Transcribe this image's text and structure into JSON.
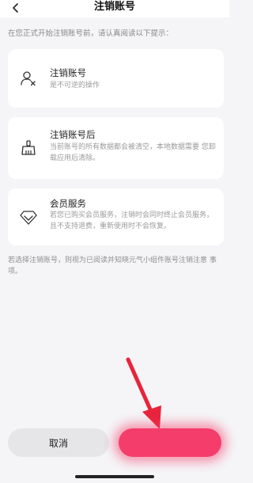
{
  "header": {
    "title": "注销账号",
    "back_icon": "chevron-left-icon"
  },
  "intro": "在您正式开始注销账号前，请认真阅读以下提示：",
  "cards": [
    {
      "icon": "user-remove-icon",
      "title": "注销账号",
      "desc": "是不可逆的操作"
    },
    {
      "icon": "broom-icon",
      "title": "注销账号后",
      "desc": "当前账号的所有数据都会被清空，本地数据需要 您卸载应用后清除。"
    },
    {
      "icon": "diamond-icon",
      "title": "会员服务",
      "desc": "若您已购买会员服务，注销时会同时终止会员服务，且不支持退费，重新使用时不会恢复。"
    }
  ],
  "note": "若选择注销账号，则视为已阅读并知晓元气小组件账号注销注意 事项。",
  "footer": {
    "cancel_label": "取消",
    "confirm_label": ""
  },
  "colors": {
    "accent": "#f43d6a",
    "annotation_arrow": "#e8243c"
  }
}
